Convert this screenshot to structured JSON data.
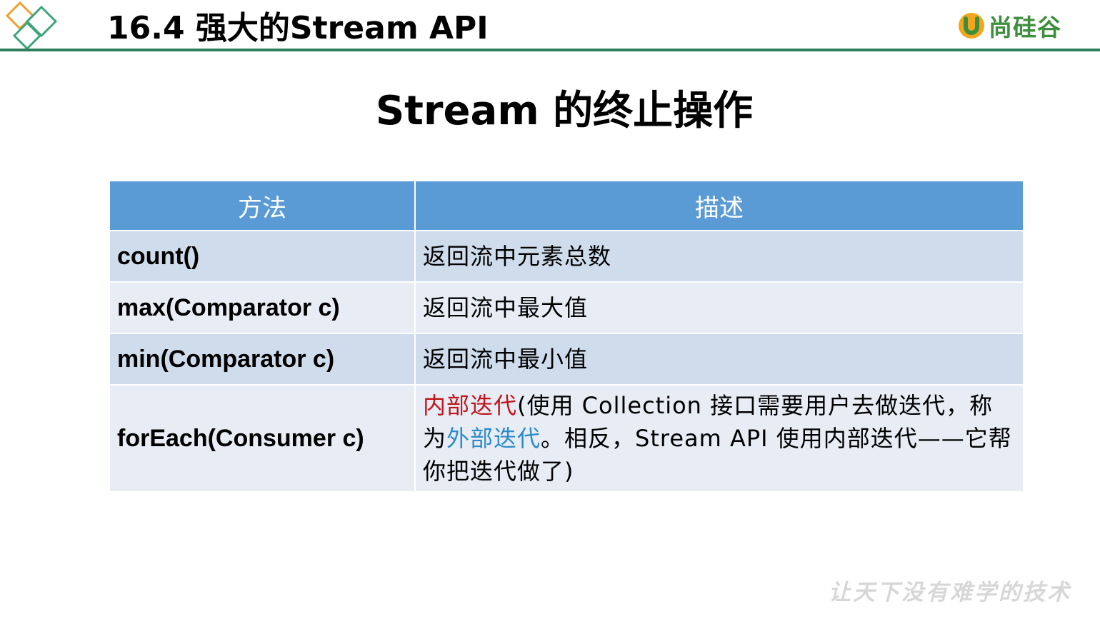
{
  "header": {
    "title": "16.4 强大的Stream API",
    "brand": "尚硅谷",
    "colors": {
      "rule": "#2e7d5b",
      "diamond_orange": "#f0a030",
      "diamond_green": "#3da57a",
      "brand_green": "#3d8f3d"
    }
  },
  "heading": "Stream 的终止操作",
  "table": {
    "header_color": "#5b9bd5",
    "columns": [
      "方法",
      "描述"
    ],
    "rows": [
      {
        "method": "count()",
        "description": "返回流中元素总数"
      },
      {
        "method": "max(Comparator c)",
        "description": "返回流中最大值"
      },
      {
        "method": "min(Comparator c)",
        "description": "返回流中最小值"
      },
      {
        "method": "forEach(Consumer c)",
        "description_parts": {
          "p1": "内部迭代",
          "p2": "(使用 Collection 接口需要用户去做迭代，称为",
          "p3": "外部迭代",
          "p4": "。相反，Stream API 使用内部迭代——它帮你把迭代做了)"
        }
      }
    ]
  },
  "footer": {
    "slogan": "让天下没有难学的技术"
  }
}
